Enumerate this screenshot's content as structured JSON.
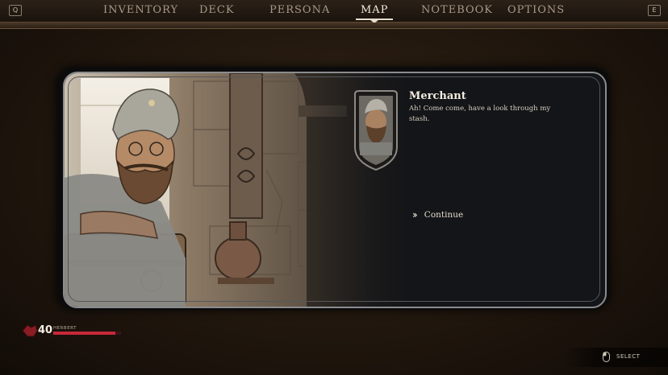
{
  "nav": {
    "prev_key": "Q",
    "next_key": "E",
    "tabs": [
      {
        "label": "INVENTORY",
        "active": false
      },
      {
        "label": "DECK",
        "active": false
      },
      {
        "label": "PERSONA",
        "active": false
      },
      {
        "label": "MAP",
        "active": true
      },
      {
        "label": "NOTEBOOK",
        "active": false
      },
      {
        "label": "OPTIONS",
        "active": false
      }
    ]
  },
  "dialogue": {
    "speaker": "Merchant",
    "line": "Ah! Come come, have a look through my stash.",
    "options": [
      {
        "label": "Continue",
        "icon": "double-chevron-right-icon"
      }
    ]
  },
  "player": {
    "name": "HERBERT",
    "health": "40",
    "health_fraction": 0.92,
    "health_color": "#c8283a"
  },
  "hints": {
    "select_label": "SELECT",
    "select_icon": "mouse-icon"
  },
  "colors": {
    "accent": "#e6dccb",
    "health": "#c8283a",
    "frame_border": "#8b8c8e"
  }
}
